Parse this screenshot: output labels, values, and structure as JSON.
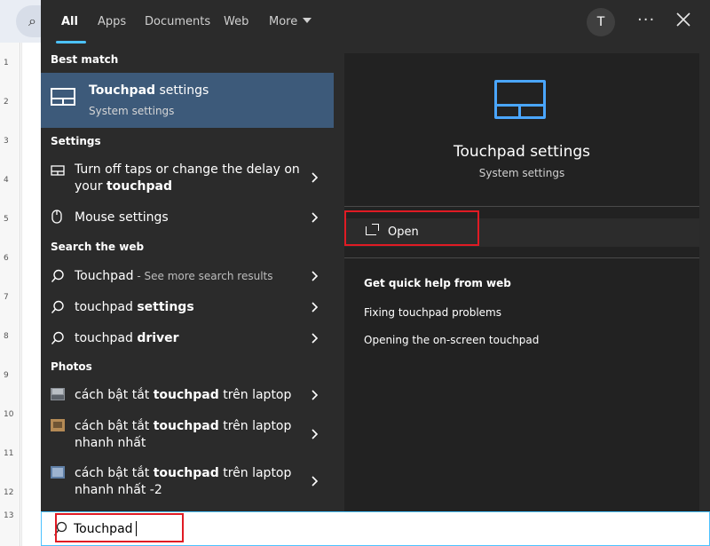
{
  "tabs": [
    {
      "label": "All",
      "active": true
    },
    {
      "label": "Apps"
    },
    {
      "label": "Documents"
    },
    {
      "label": "Web"
    },
    {
      "label": "More"
    }
  ],
  "avatar_initial": "T",
  "more_dots": "···",
  "sections": {
    "best_match": "Best match",
    "settings": "Settings",
    "search_web": "Search the web",
    "photos": "Photos"
  },
  "best_match": {
    "title_bold": "Touchpad",
    "title_rest": " settings",
    "subtitle": "System settings",
    "icon": "touchpad-icon"
  },
  "settings_items": [
    {
      "pre": "Turn off taps or change the delay on",
      "line2_pre": "your ",
      "bold": "touchpad",
      "icon": "touchpad-icon"
    },
    {
      "label": "Mouse settings",
      "icon": "mouse-icon"
    }
  ],
  "web_items": [
    {
      "main": "Touchpad",
      "suffix": " - See more search results",
      "icon": "search-icon"
    },
    {
      "pre": "touchpad ",
      "bold": "settings",
      "icon": "search-icon"
    },
    {
      "pre": "touchpad ",
      "bold": "driver",
      "icon": "search-icon"
    }
  ],
  "photo_items": [
    {
      "pre": "cách bật tắt ",
      "bold": "touchpad",
      "post": " trên laptop",
      "line2": ""
    },
    {
      "pre": "cách bật tắt ",
      "bold": "touchpad",
      "post": " trên laptop",
      "line2": "nhanh nhất"
    },
    {
      "pre": "cách bật tắt ",
      "bold": "touchpad",
      "post": " trên laptop",
      "line2": "nhanh nhất -2"
    }
  ],
  "preview": {
    "title": "Touchpad settings",
    "subtitle": "System settings",
    "open_label": "Open",
    "quick_help_heading": "Get quick help from web",
    "links": [
      "Fixing touchpad problems",
      "Opening the on-screen touchpad"
    ]
  },
  "search": {
    "value": "Touchpad",
    "icon": "search-icon"
  },
  "ruler_numbers": [
    "1",
    "2",
    "3",
    "4",
    "5",
    "6",
    "7",
    "8",
    "9",
    "10",
    "11",
    "12",
    "13"
  ],
  "colors": {
    "accent": "#4cc2ff",
    "best_match_bg": "#3d5a7a",
    "highlight": "#e01b24",
    "panel_bg": "#2b2b2b"
  }
}
